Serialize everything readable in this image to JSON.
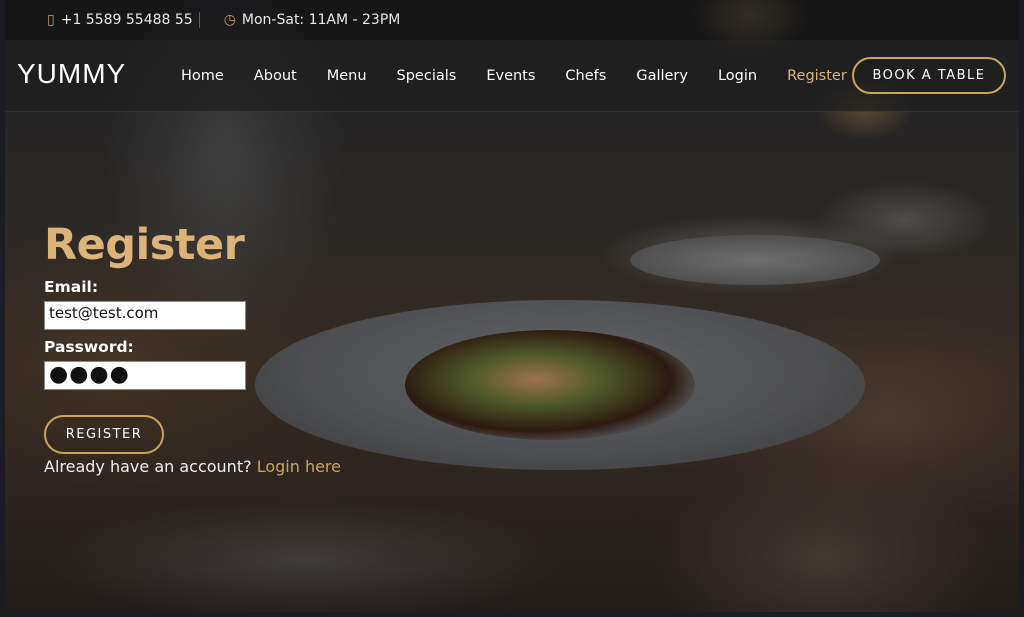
{
  "topbar": {
    "phone_icon": "phone-icon",
    "phone": "+1 5589 55488 55",
    "clock_icon": "clock-icon",
    "hours": "Mon-Sat: 11AM - 23PM"
  },
  "header": {
    "logo": "YUMMY",
    "nav": [
      "Home",
      "About",
      "Menu",
      "Specials",
      "Events",
      "Chefs",
      "Gallery",
      "Login",
      "Register"
    ],
    "active_nav": "Register",
    "cta": "BOOK A TABLE"
  },
  "register": {
    "title": "Register",
    "email_label": "Email:",
    "email_value": "test@test.com",
    "password_label": "Password:",
    "password_value": "●●●●",
    "submit": "REGISTER",
    "login_prompt": "Already have an account?",
    "login_link": "Login here"
  },
  "colors": {
    "accent": "#cda45e",
    "title": "#dcb47a"
  }
}
